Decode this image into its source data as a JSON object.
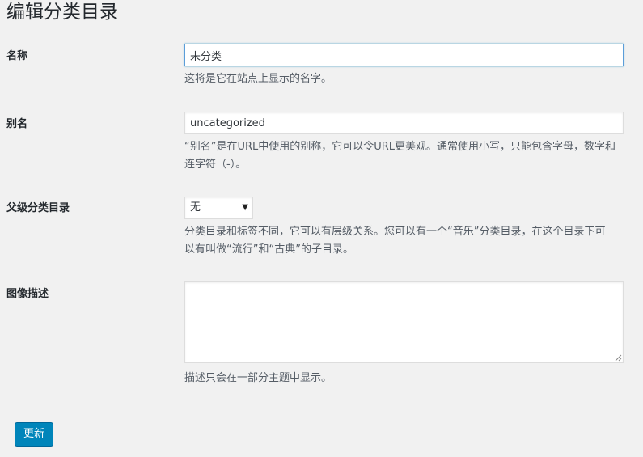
{
  "page": {
    "title": "编辑分类目录"
  },
  "fields": {
    "name": {
      "label": "名称",
      "value": "未分类",
      "description": "这将是它在站点上显示的名字。"
    },
    "slug": {
      "label": "别名",
      "value": "uncategorized",
      "description_line1": "“别名”是在URL中使用的别称，它可以令URL更美观。通常使用小写，只能包含字母，数字和",
      "description_line2": "连字符（-）。"
    },
    "parent": {
      "label": "父级分类目录",
      "selected": "无",
      "description_line1": "分类目录和标签不同，它可以有层级关系。您可以有一个“音乐”分类目录，在这个目录下可",
      "description_line2": "以有叫做“流行”和“古典”的子目录。"
    },
    "description": {
      "label": "图像描述",
      "value": "",
      "description": "描述只会在一部分主题中显示。"
    }
  },
  "actions": {
    "update_label": "更新"
  },
  "colors": {
    "background": "#f1f1f1",
    "primary_button": "#0085ba",
    "focus_border": "#5b9dd9",
    "description_text": "#555d66"
  },
  "icons": {
    "select_arrow": "triangle-down-icon",
    "textarea_resize": "resize-grip-icon"
  }
}
